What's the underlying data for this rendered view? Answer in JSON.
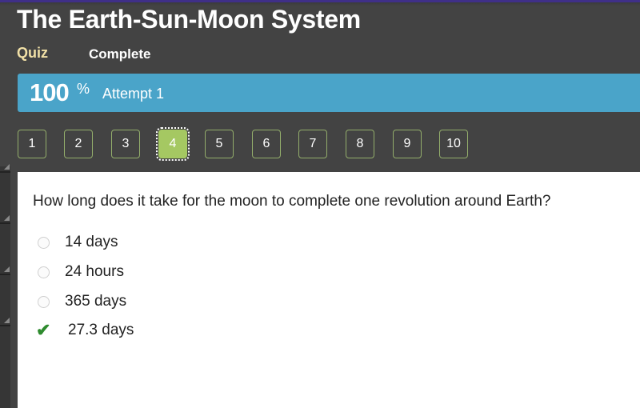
{
  "header": {
    "title": "The Earth-Sun-Moon System",
    "activity_type": "Quiz",
    "status": "Complete"
  },
  "result_banner": {
    "score": "100",
    "score_unit": "%",
    "attempt": "Attempt 1",
    "color": "#4aa4c9"
  },
  "question_nav": {
    "current": 4,
    "items": [
      "1",
      "2",
      "3",
      "4",
      "5",
      "6",
      "7",
      "8",
      "9",
      "10"
    ],
    "accent": "#a5c862"
  },
  "question": {
    "text": "How long does it take for the moon to complete one revolution around Earth?",
    "options": [
      {
        "label": "14 days",
        "state": "unselected"
      },
      {
        "label": "24 hours",
        "state": "unselected"
      },
      {
        "label": "365 days",
        "state": "unselected"
      },
      {
        "label": "27.3 days",
        "state": "correct",
        "icon": "checkmark-icon"
      }
    ],
    "correct_color": "#2e8b2e"
  }
}
